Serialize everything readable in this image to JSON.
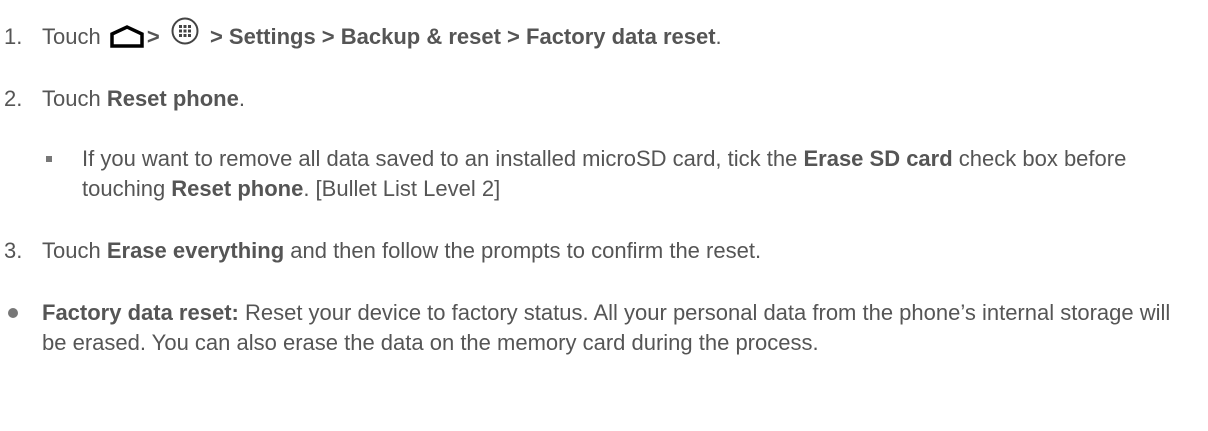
{
  "step1": {
    "number": "1.",
    "prefix": "Touch",
    "home_icon": "home-outline-icon",
    "sep1": ">",
    "apps_icon": "all-apps-grid-icon",
    "path": "> Settings > Backup & reset > Factory data reset",
    "end": "."
  },
  "step2": {
    "number": "2.",
    "prefix": "Touch ",
    "bold": "Reset phone",
    "end": "."
  },
  "sub_bullet": {
    "t1": "If you want to remove all data saved to an installed microSD card, tick the ",
    "b1": "Erase SD card",
    "t2": " check box before touching ",
    "b2": "Reset phone",
    "t3": ". [Bullet List Level 2]"
  },
  "step3": {
    "number": "3.",
    "prefix": "Touch ",
    "bold": "Erase everything",
    "rest": " and then follow the prompts to confirm the reset."
  },
  "bullet": {
    "bold": "Factory data reset:",
    "rest": " Reset your device to factory status. All your personal data from the phone’s internal storage will be erased. You can also erase the data on the memory card during the process."
  }
}
